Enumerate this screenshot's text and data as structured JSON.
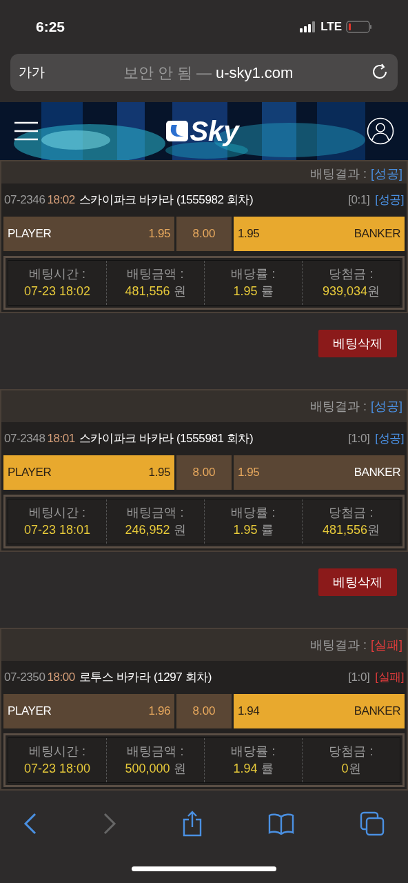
{
  "status_bar": {
    "time": "6:25",
    "network": "LTE"
  },
  "browser": {
    "text_size": "가가",
    "security_label": "보안 안 됨 —",
    "url": "u-sky1.com"
  },
  "header": {
    "logo_text": "Sky"
  },
  "bets": [
    {
      "result": {
        "label": "배팅결과 :",
        "status": "[성공]",
        "kind": "success"
      },
      "info": {
        "code": "07-2346",
        "time": "18:02",
        "game": "스카이파크 바카라 (1555982 회차)",
        "score": "[0:1]",
        "status": "[성공]",
        "kind": "success"
      },
      "odds": {
        "player": {
          "label": "PLAYER",
          "odds": "1.95",
          "selected": false
        },
        "tie": "8.00",
        "banker": {
          "label": "BANKER",
          "odds": "1.95",
          "selected": true
        }
      },
      "details": [
        {
          "label": "베팅시간 :",
          "value": "07-23 18:02"
        },
        {
          "label": "배팅금액 :",
          "value": "481,556",
          "unit": " 원"
        },
        {
          "label": "배당률 :",
          "value": "1.95",
          "unit": " 률"
        },
        {
          "label": "당첨금 :",
          "value": "939,034",
          "unit": "원"
        }
      ],
      "delete_button": "베팅삭제"
    },
    {
      "result": {
        "label": "배팅결과 :",
        "status": "[성공]",
        "kind": "success"
      },
      "info": {
        "code": "07-2348",
        "time": "18:01",
        "game": "스카이파크 바카라 (1555981 회차)",
        "score": "[1:0]",
        "status": "[성공]",
        "kind": "success"
      },
      "odds": {
        "player": {
          "label": "PLAYER",
          "odds": "1.95",
          "selected": true
        },
        "tie": "8.00",
        "banker": {
          "label": "BANKER",
          "odds": "1.95",
          "selected": false
        }
      },
      "details": [
        {
          "label": "베팅시간 :",
          "value": "07-23 18:01"
        },
        {
          "label": "배팅금액 :",
          "value": "246,952",
          "unit": " 원"
        },
        {
          "label": "배당률 :",
          "value": "1.95",
          "unit": " 률"
        },
        {
          "label": "당첨금 :",
          "value": "481,556",
          "unit": "원"
        }
      ],
      "delete_button": "베팅삭제"
    },
    {
      "result": {
        "label": "배팅결과 :",
        "status": "[실패]",
        "kind": "fail"
      },
      "info": {
        "code": "07-2350",
        "time": "18:00",
        "game": "로투스 바카라 (1297 회차)",
        "score": "[1:0]",
        "status": "[실패]",
        "kind": "fail"
      },
      "odds": {
        "player": {
          "label": "PLAYER",
          "odds": "1.96",
          "selected": false
        },
        "tie": "8.00",
        "banker": {
          "label": "BANKER",
          "odds": "1.94",
          "selected": true
        }
      },
      "details": [
        {
          "label": "베팅시간 :",
          "value": "07-23 18:00"
        },
        {
          "label": "배팅금액 :",
          "value": "500,000",
          "unit": " 원"
        },
        {
          "label": "배당률 :",
          "value": "1.94",
          "unit": " 률"
        },
        {
          "label": "당첨금 :",
          "value": "0",
          "unit": "원"
        }
      ]
    }
  ]
}
